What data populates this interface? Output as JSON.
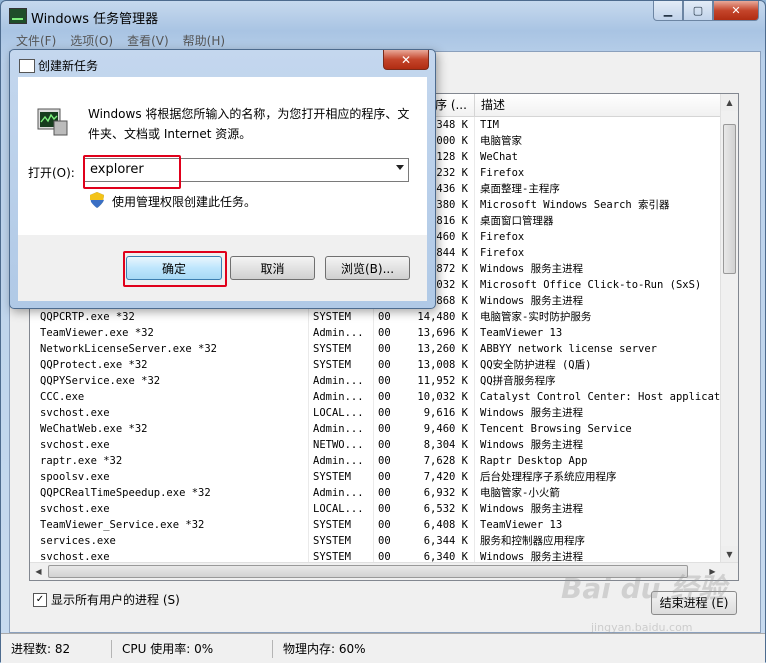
{
  "window": {
    "title": "Windows 任务管理器"
  },
  "menu": [
    "文件(F)",
    "选项(O)",
    "查看(V)",
    "帮助(H)"
  ],
  "columns": {
    "mem_header": "序 (...",
    "desc_header": "描述"
  },
  "processes": [
    {
      "name": "",
      "user": "",
      "cpu": "",
      "mem": "348 K",
      "desc": "TIM"
    },
    {
      "name": "",
      "user": "",
      "cpu": "",
      "mem": "000 K",
      "desc": "电脑管家"
    },
    {
      "name": "",
      "user": "",
      "cpu": "",
      "mem": "128 K",
      "desc": "WeChat"
    },
    {
      "name": "",
      "user": "",
      "cpu": "",
      "mem": "232 K",
      "desc": "Firefox"
    },
    {
      "name": "",
      "user": "",
      "cpu": "",
      "mem": "436 K",
      "desc": "桌面整理-主程序"
    },
    {
      "name": "",
      "user": "",
      "cpu": "",
      "mem": "380 K",
      "desc": "Microsoft Windows Search 索引器"
    },
    {
      "name": "",
      "user": "",
      "cpu": "",
      "mem": "816 K",
      "desc": "桌面窗口管理器"
    },
    {
      "name": "",
      "user": "",
      "cpu": "",
      "mem": "460 K",
      "desc": "Firefox"
    },
    {
      "name": "",
      "user": "",
      "cpu": "",
      "mem": "844 K",
      "desc": "Firefox"
    },
    {
      "name": "",
      "user": "",
      "cpu": "",
      "mem": "872 K",
      "desc": "Windows 服务主进程"
    },
    {
      "name": "",
      "user": "",
      "cpu": "",
      "mem": "032 K",
      "desc": "Microsoft Office Click-to-Run (SxS)"
    },
    {
      "name": "",
      "user": "",
      "cpu": "",
      "mem": "868 K",
      "desc": "Windows 服务主进程"
    },
    {
      "name": "QQPCRTP.exe *32",
      "user": "SYSTEM",
      "cpu": "00",
      "mem": "14,480 K",
      "desc": "电脑管家-实时防护服务"
    },
    {
      "name": "TeamViewer.exe *32",
      "user": "Admin...",
      "cpu": "00",
      "mem": "13,696 K",
      "desc": "TeamViewer 13"
    },
    {
      "name": "NetworkLicenseServer.exe *32",
      "user": "SYSTEM",
      "cpu": "00",
      "mem": "13,260 K",
      "desc": "ABBYY network license server"
    },
    {
      "name": "QQProtect.exe *32",
      "user": "SYSTEM",
      "cpu": "00",
      "mem": "13,008 K",
      "desc": "QQ安全防护进程 (Q盾)"
    },
    {
      "name": "QQPYService.exe *32",
      "user": "Admin...",
      "cpu": "00",
      "mem": "11,952 K",
      "desc": "QQ拼音服务程序"
    },
    {
      "name": "CCC.exe",
      "user": "Admin...",
      "cpu": "00",
      "mem": "10,032 K",
      "desc": "Catalyst Control Center: Host application"
    },
    {
      "name": "svchost.exe",
      "user": "LOCAL...",
      "cpu": "00",
      "mem": "9,616 K",
      "desc": "Windows 服务主进程"
    },
    {
      "name": "WeChatWeb.exe *32",
      "user": "Admin...",
      "cpu": "00",
      "mem": "9,460 K",
      "desc": "Tencent Browsing Service"
    },
    {
      "name": "svchost.exe",
      "user": "NETWO...",
      "cpu": "00",
      "mem": "8,304 K",
      "desc": "Windows 服务主进程"
    },
    {
      "name": "raptr.exe *32",
      "user": "Admin...",
      "cpu": "00",
      "mem": "7,628 K",
      "desc": "Raptr Desktop App"
    },
    {
      "name": "spoolsv.exe",
      "user": "SYSTEM",
      "cpu": "00",
      "mem": "7,420 K",
      "desc": "后台处理程序子系统应用程序"
    },
    {
      "name": "QQPCRealTimeSpeedup.exe *32",
      "user": "Admin...",
      "cpu": "00",
      "mem": "6,932 K",
      "desc": "电脑管家-小火箭"
    },
    {
      "name": "svchost.exe",
      "user": "LOCAL...",
      "cpu": "00",
      "mem": "6,532 K",
      "desc": "Windows 服务主进程"
    },
    {
      "name": "TeamViewer_Service.exe *32",
      "user": "SYSTEM",
      "cpu": "00",
      "mem": "6,408 K",
      "desc": "TeamViewer 13"
    },
    {
      "name": "services.exe",
      "user": "SYSTEM",
      "cpu": "00",
      "mem": "6,344 K",
      "desc": "服务和控制器应用程序"
    },
    {
      "name": "svchost.exe",
      "user": "SYSTEM",
      "cpu": "00",
      "mem": "6,340 K",
      "desc": "Windows 服务主进程"
    }
  ],
  "show_all_label": "显示所有用户的进程 (S)",
  "end_process_label": "结束进程 (E)",
  "status": {
    "processes": "进程数: 82",
    "cpu": "CPU 使用率: 0%",
    "memory": "物理内存: 60%"
  },
  "dialog": {
    "title": "创建新任务",
    "description": "Windows 将根据您所输入的名称，为您打开相应的程序、文件夹、文档或 Internet 资源。",
    "open_label": "打开(O):",
    "open_value": "explorer",
    "admin_text": "使用管理权限创建此任务。",
    "ok_label": "确定",
    "cancel_label": "取消",
    "browse_label": "浏览(B)..."
  },
  "watermark": "Bai du 经验",
  "watermark_url": "jingyan.baidu.com"
}
